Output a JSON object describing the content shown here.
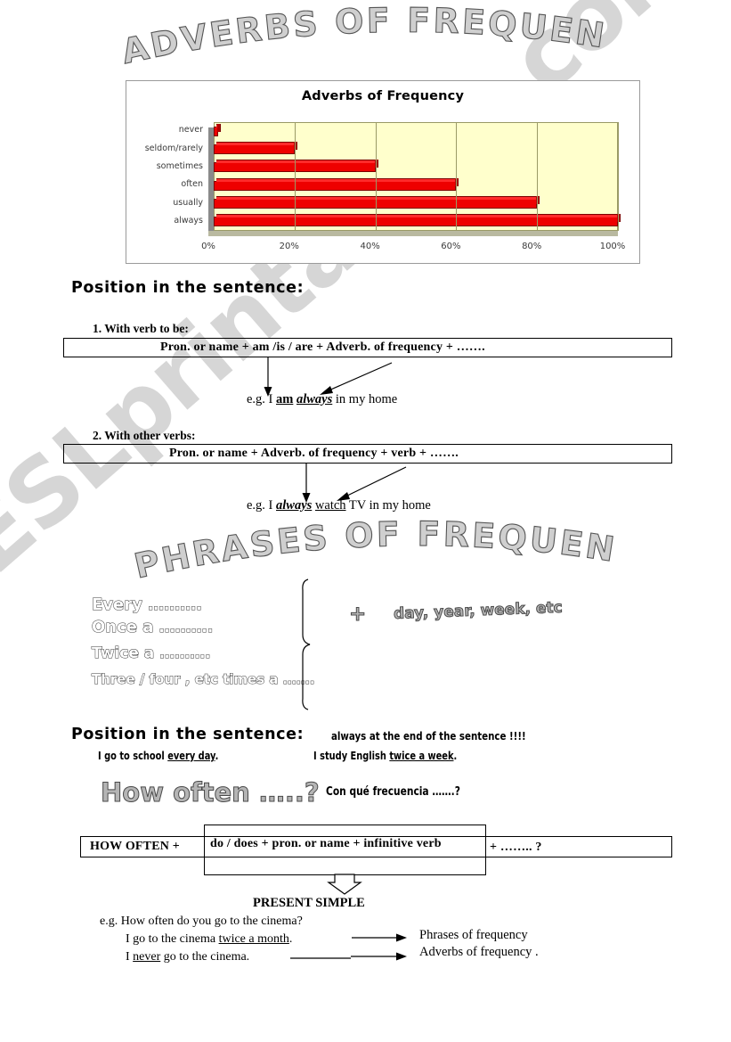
{
  "titles": {
    "main": "ADVERBS OF FREQUENCY",
    "phrases": "PHRASES OF FREQUENCY"
  },
  "chart_data": {
    "type": "bar",
    "orientation": "horizontal",
    "title": "Adverbs of Frequency",
    "categories": [
      "never",
      "seldom/rarely",
      "sometimes",
      "often",
      "usually",
      "always"
    ],
    "values": [
      1,
      20,
      40,
      60,
      80,
      100
    ],
    "xlabel": "",
    "ylabel": "",
    "xlim": [
      0,
      100
    ],
    "xticks": [
      "0%",
      "20%",
      "40%",
      "60%",
      "80%",
      "100%"
    ],
    "grid": true,
    "legend": false,
    "bar_color": "#ee0000",
    "plot_bg_color": "#ffffcc"
  },
  "section1": {
    "heading": "Position in the sentence:",
    "rule1_label": "1.   With verb to be:",
    "rule1_formula": "Pron. or name   +   am /is / are   +   Adverb. of frequency + …….",
    "rule1_example_prefix": "e.g.   I ",
    "rule1_example_verb": "am",
    "rule1_example_adverb": "always",
    "rule1_example_suffix": " in my home",
    "rule2_label": "2.   With other verbs:",
    "rule2_formula": "Pron. or name      +    Adverb. of frequency +   verb +    …….",
    "rule2_example_prefix": "e.g.   I ",
    "rule2_example_adverb": "always",
    "rule2_example_verb": "watch",
    "rule2_example_suffix": "  TV in my home"
  },
  "phrases": {
    "items": [
      "Every ……….",
      "Once a ……….",
      "Twice a ……….",
      "Three / four , etc times a ……."
    ],
    "plus_sign": "+",
    "right_text": "day, year, week, etc"
  },
  "section2": {
    "heading": "Position in the sentence:",
    "note": "always at the end of the sentence  !!!!",
    "example_left_prefix": "I go to school ",
    "example_left_underlined": "every day",
    "example_left_suffix": ".",
    "example_right_prefix": "I study English ",
    "example_right_underlined": "twice a week",
    "example_right_suffix": ".",
    "how_often": "How often …..?",
    "how_often_spanish": "Con qué frecuencia …….?"
  },
  "section3": {
    "formula_prefix": "HOW OFTEN  + ",
    "formula_inner": "do / does  + pron. or name   + infinitive verb",
    "formula_suffix": " + …….. ?",
    "present_simple": "PRESENT SIMPLE",
    "eg_question_prefix": "e.g. ",
    "eg_question": "How often do you go to the cinema?",
    "eg_answer1_prefix": "I go to the cinema ",
    "eg_answer1_underlined": "twice a month",
    "eg_answer1_suffix": ".",
    "eg_answer2_prefix": "I ",
    "eg_answer2_underlined": "never",
    "eg_answer2_suffix": " go to the cinema.",
    "label1": "Phrases of frequency",
    "label2": "Adverbs of frequency ."
  },
  "watermark": {
    "text": "ESLprintables.com"
  }
}
